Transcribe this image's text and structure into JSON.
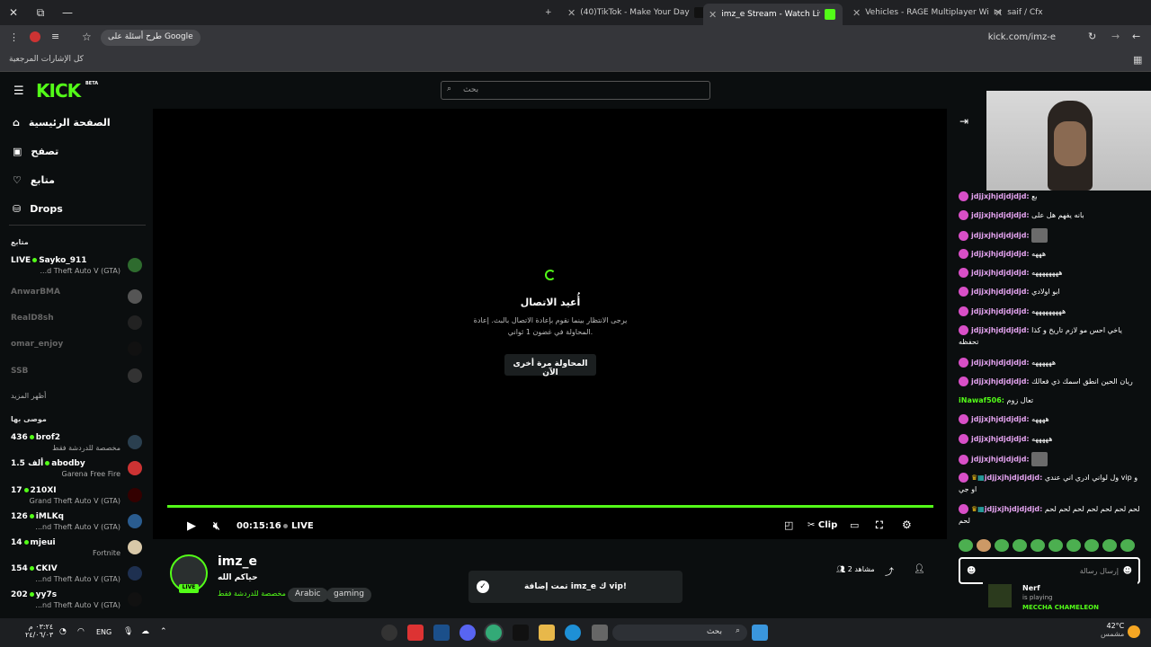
{
  "browser": {
    "tabs": [
      {
        "label": "(40)TikTok - Make Your Day"
      },
      {
        "label": "imz_e Stream - Watch Live on K"
      },
      {
        "label": "Vehicles - RAGE Multiplayer Wi"
      },
      {
        "label": "saif / Cfx"
      }
    ],
    "search_pill": "طرح أسئلة على Google",
    "url": "kick.com/imz-e",
    "bookmarks_label": "كل الإشارات المرجعية"
  },
  "site": {
    "logo": "KICK",
    "logo_badge": "BETA",
    "search_placeholder": "بحث"
  },
  "sidebar": {
    "nav": [
      {
        "label": "الصفحة الرئيسية",
        "icon": "home-icon"
      },
      {
        "label": "تصفح",
        "icon": "browse-icon"
      },
      {
        "label": "متابع",
        "icon": "heart-icon"
      },
      {
        "label": "Drops",
        "icon": "drops-icon"
      }
    ],
    "following_heading": "متابع",
    "following": [
      {
        "name": "LIVE",
        "user": "Sayko_911",
        "sub": "...d Theft Auto V (GTA)",
        "live": true
      },
      {
        "user": "AnwarBMA",
        "live": false
      },
      {
        "user": "RealD8sh",
        "live": false
      },
      {
        "user": "omar_enjoy",
        "live": false
      },
      {
        "user": "SSB",
        "live": false
      }
    ],
    "show_more": "أظهر المزيد",
    "recommended_heading": "موصى بها",
    "recommended": [
      {
        "viewers": "436",
        "user": "brof2",
        "sub": "مخصصة للدردشة فقط"
      },
      {
        "viewers": "1.5 ألف",
        "user": "abodby",
        "sub": "Garena Free Fire"
      },
      {
        "viewers": "17",
        "user": "210XI",
        "sub": "Grand Theft Auto V (GTA)"
      },
      {
        "viewers": "126",
        "user": "iMLKq",
        "sub": "...nd Theft Auto V (GTA)"
      },
      {
        "viewers": "14",
        "user": "mjeui",
        "sub": "Fortnite"
      },
      {
        "viewers": "154",
        "user": "CKIV",
        "sub": "...nd Theft Auto V (GTA)"
      },
      {
        "viewers": "202",
        "user": "yy7s",
        "sub": "...nd Theft Auto V (GTA)"
      }
    ]
  },
  "player": {
    "reconnect_title": "أُعيد الاتصال",
    "reconnect_body": "يرجى الانتظار بينما نقوم بإعادة الاتصال بالبث. إعادة المحاولة في غضون 1 ثواني.",
    "retry_label": "المحاولة مرة أخرى الآن",
    "time": "00:15:16",
    "live_label": "LIVE",
    "clip_label": "Clip"
  },
  "stream": {
    "streamer": "imz_e",
    "live_badge": "LIVE",
    "title": "حياكم الله",
    "category": "مخصصة للدردشة فقط",
    "tags": [
      "Arabic",
      "gaming"
    ],
    "viewers_label": "مشاهد 2"
  },
  "toast": {
    "message": "تمت إضافة imz_e ك vip!"
  },
  "chat": {
    "messages": [
      {
        "user": "jdjjxjhjdjdjdjd:",
        "text": "بع"
      },
      {
        "user": "jdjjxjhjdjdjdjd:",
        "text": "بانه يفهم هل على"
      },
      {
        "user": "jdjjxjhjdjdjdjd:",
        "text": ""
      },
      {
        "user": "jdjjxjhjdjdjdjd:",
        "text": "هههه"
      },
      {
        "user": "jdjjxjhjdjdjdjd:",
        "text": "ههههههههه"
      },
      {
        "user": "jdjjxjhjdjdjdjd:",
        "text": "ابو اولادي"
      },
      {
        "user": "jdjjxjhjdjdjdjd:",
        "text": "هههههههههه"
      },
      {
        "user": "jdjjxjhjdjdjdjd:",
        "text": "ياخي احس مو لازم تاريخ و كذا تحفظه"
      },
      {
        "user": "jdjjxjhjdjdjdjd:",
        "text": "ههههههه"
      },
      {
        "user": "jdjjxjhjdjdjdjd:",
        "text": "ريان الحين انطق اسمك ذي فعالك"
      },
      {
        "user": "iNawaf506:",
        "text": "تعال زوم",
        "green": true
      },
      {
        "user": "jdjjxjhjdjdjdjd:",
        "text": "ههههه"
      },
      {
        "user": "jdjjxjhjdjdjdjd:",
        "text": "هههههه"
      },
      {
        "user": "jdjjxjhjdjdjdjd:",
        "text": ""
      },
      {
        "user": "jdjjxjhjdjdjdjd:",
        "text": "ول لواني ادري اني عندي vip و او جي"
      },
      {
        "user": "jdjjxjhjdjdjdjd:",
        "text": "لحم لحم لحم لحم لحم لحم لحم لحم"
      }
    ],
    "input_placeholder": "إرسال رسالة"
  },
  "now_playing": {
    "name": "Nerf",
    "status": "is playing",
    "game": "MECCHA CHAMELEON"
  },
  "taskbar": {
    "time": "٠٣:٢٤ م",
    "date": "٢٤/٠٦/٠٣",
    "lang": "ENG",
    "search": "بحث",
    "temp": "42°C",
    "weather": "مشمس"
  }
}
